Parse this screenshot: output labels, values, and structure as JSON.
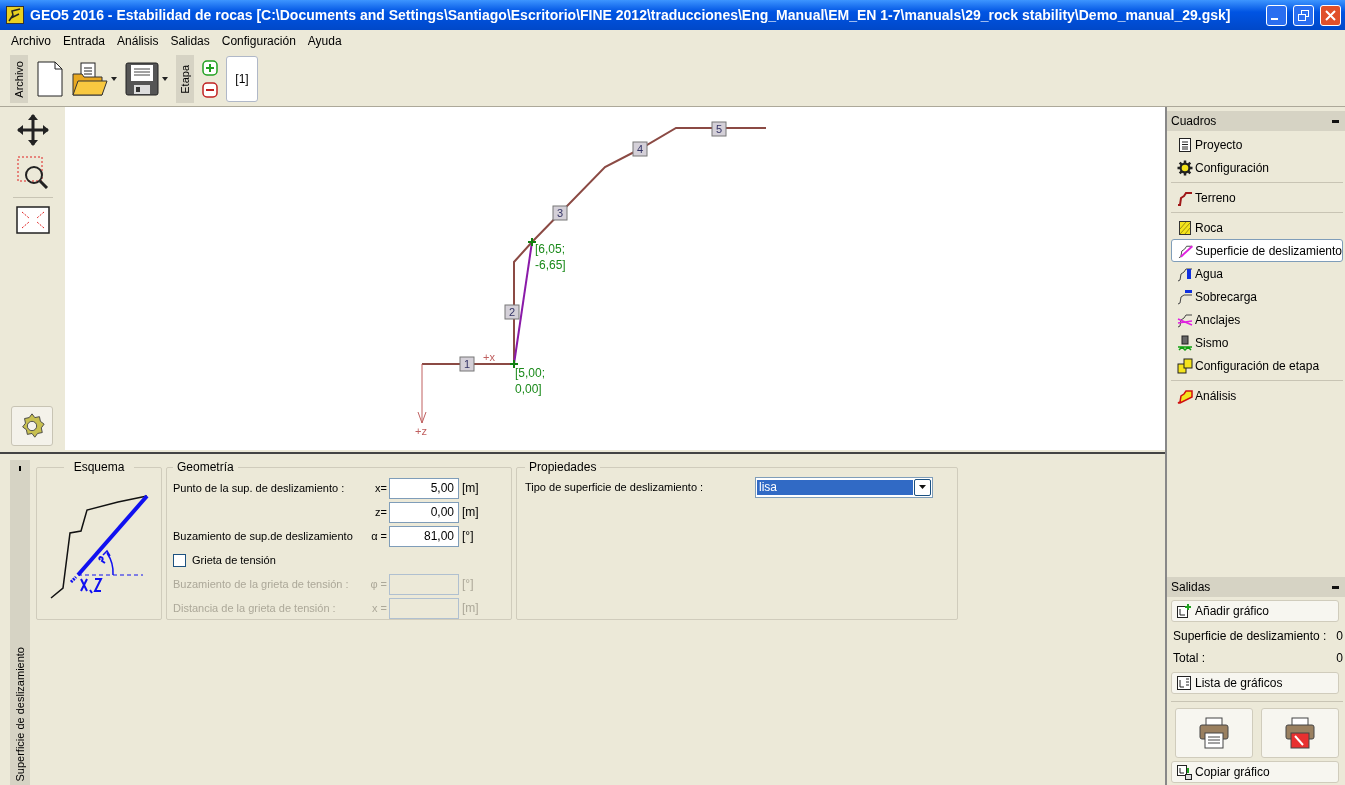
{
  "window": {
    "title": "GEO5 2016 - Estabilidad de rocas [C:\\Documents and Settings\\Santiago\\Escritorio\\FINE 2012\\traducciones\\Eng_Manual\\EM_EN 1-7\\manuals\\29_rock stability\\Demo_manual_29.gsk]"
  },
  "menu": [
    "Archivo",
    "Entrada",
    "Análisis",
    "Salidas",
    "Configuración",
    "Ayuda"
  ],
  "toolbar": {
    "file_label": "Archivo",
    "stage_label": "Etapa",
    "stages": [
      {
        "label": "[1]",
        "selected": true
      }
    ]
  },
  "canvas": {
    "x_axis_label": "+x",
    "z_axis_label": "+z",
    "segments": [
      {
        "label": "1"
      },
      {
        "label": "2"
      },
      {
        "label": "3"
      },
      {
        "label": "4"
      },
      {
        "label": "5"
      }
    ],
    "points": [
      {
        "lines": [
          "[6,05;",
          "-6,65]"
        ]
      },
      {
        "lines": [
          "[5,00;",
          "0,00]"
        ]
      }
    ]
  },
  "bottom": {
    "tab": "Superficie de deslizamiento",
    "scheme": {
      "title": "Esquema"
    },
    "geometry": {
      "title": "Geometría",
      "rows": [
        {
          "kind": "field",
          "label": "Punto de la sup. de deslizamiento :",
          "symbol": "x=",
          "value": "5,00",
          "unit": "[m]",
          "disabled": false
        },
        {
          "kind": "field",
          "symbol": "z=",
          "value": "0,00",
          "unit": "[m]",
          "disabled": false
        },
        {
          "kind": "field",
          "label": "Buzamiento de sup.de deslizamiento",
          "symbol": "α =",
          "value": "81,00",
          "unit": "[°]",
          "disabled": false
        },
        {
          "kind": "checkbox",
          "label": "Grieta de tensión",
          "checked": false
        },
        {
          "kind": "field",
          "label": "Buzamiento de la grieta de tensión :",
          "symbol": "φ =",
          "unit": "[°]",
          "disabled": true
        },
        {
          "kind": "field",
          "label": "Distancia de la grieta de tensión :",
          "symbol": "x =",
          "unit": "[m]",
          "disabled": true
        }
      ]
    },
    "properties": {
      "title": "Propiedades",
      "label": "Tipo de superficie de deslizamiento :",
      "value": "lisa"
    }
  },
  "sidebar": {
    "title": "Cuadros",
    "groups": [
      {
        "items": [
          {
            "label": "Proyecto",
            "kind": "document",
            "selected": false
          },
          {
            "label": "Configuración",
            "kind": "gear",
            "selected": false
          }
        ]
      },
      {
        "items": [
          {
            "label": "Terreno",
            "kind": "terrain",
            "selected": false
          }
        ]
      },
      {
        "items": [
          {
            "label": "Roca",
            "kind": "rock",
            "selected": false
          },
          {
            "label": "Superficie de deslizamiento",
            "kind": "slip",
            "selected": true
          },
          {
            "label": "Agua",
            "kind": "water",
            "selected": false
          },
          {
            "label": "Sobrecarga",
            "kind": "surcharge",
            "selected": false
          },
          {
            "label": "Anclajes",
            "kind": "anchor",
            "selected": false
          },
          {
            "label": "Sismo",
            "kind": "seismic",
            "selected": false
          },
          {
            "label": "Configuración de etapa",
            "kind": "stage",
            "selected": false
          }
        ]
      },
      {
        "items": [
          {
            "label": "Análisis",
            "kind": "analysis",
            "selected": false
          }
        ]
      }
    ]
  },
  "outputs": {
    "title": "Salidas",
    "add_button": "Añadir gráfico",
    "counts": [
      {
        "label": "Superficie de deslizamiento :",
        "value": "0"
      },
      {
        "label": "Total :",
        "value": "0"
      }
    ],
    "list_button": "Lista de gráficos",
    "copy_button": "Copiar gráfico"
  }
}
